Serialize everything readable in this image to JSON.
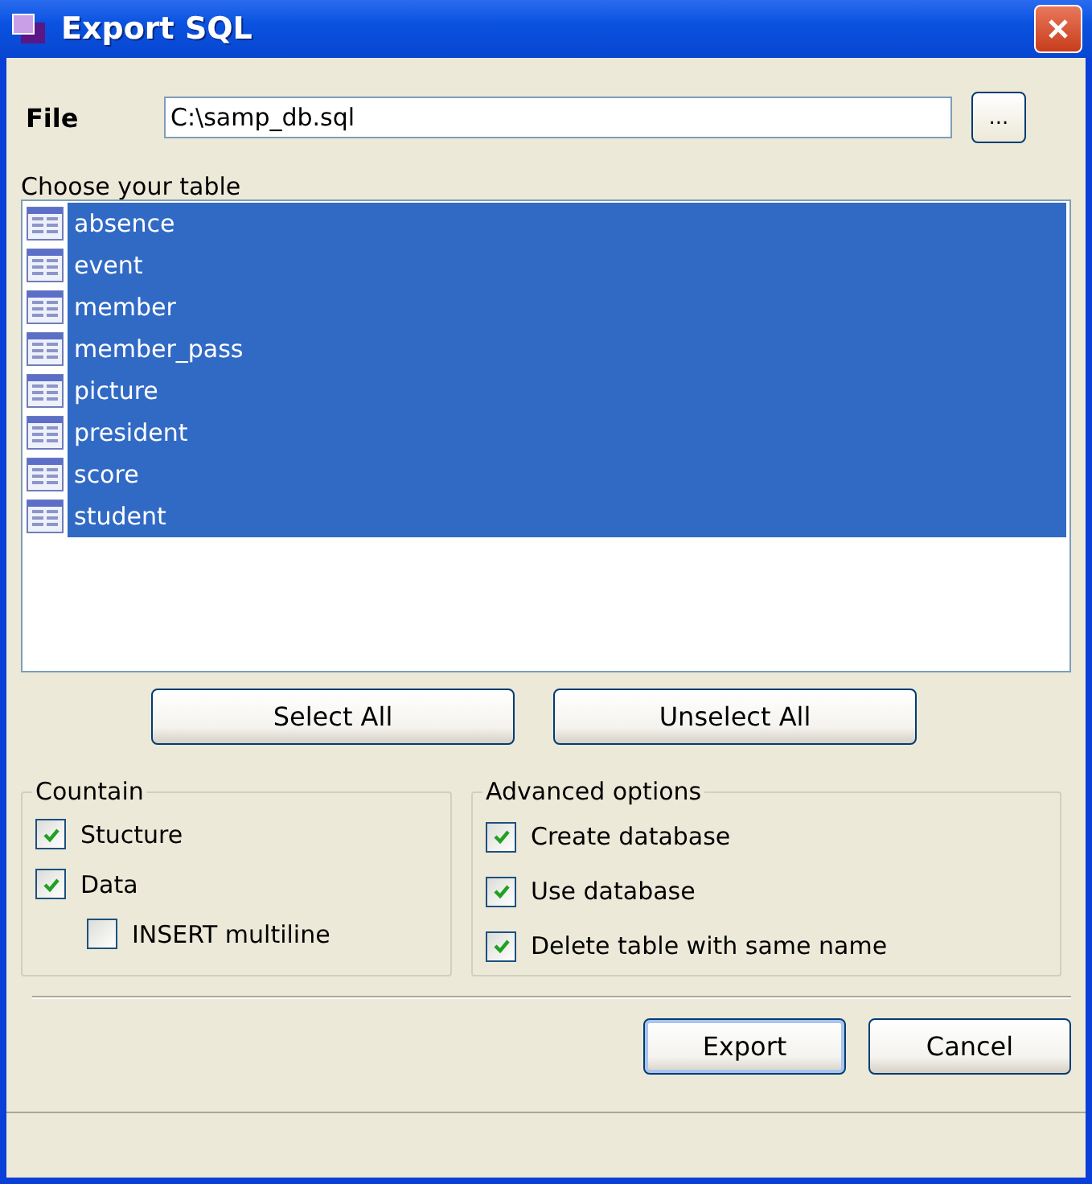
{
  "window": {
    "title": "Export SQL"
  },
  "file": {
    "label": "File",
    "value": "C:\\samp_db.sql",
    "browse_button": "..."
  },
  "table_list": {
    "label": "Choose your table",
    "items": [
      {
        "name": "absence",
        "selected": true
      },
      {
        "name": "event",
        "selected": true
      },
      {
        "name": "member",
        "selected": true
      },
      {
        "name": "member_pass",
        "selected": true
      },
      {
        "name": "picture",
        "selected": true
      },
      {
        "name": "president",
        "selected": true
      },
      {
        "name": "score",
        "selected": true
      },
      {
        "name": "student",
        "selected": true
      }
    ]
  },
  "list_buttons": [
    "Select All",
    "Unselect All"
  ],
  "groups": [
    {
      "title": "Countain",
      "options": [
        {
          "label": "Stucture",
          "checked": true
        },
        {
          "label": "Data",
          "checked": true,
          "children": [
            {
              "label": "INSERT multiline",
              "checked": false
            }
          ]
        }
      ]
    },
    {
      "title": "Advanced options",
      "options": [
        {
          "label": "Create database",
          "checked": true
        },
        {
          "label": "Use database",
          "checked": true
        },
        {
          "label": "Delete table with same name",
          "checked": true
        }
      ]
    }
  ],
  "buttons": [
    {
      "label": "Export",
      "default": true
    },
    {
      "label": "Cancel",
      "default": false
    }
  ]
}
